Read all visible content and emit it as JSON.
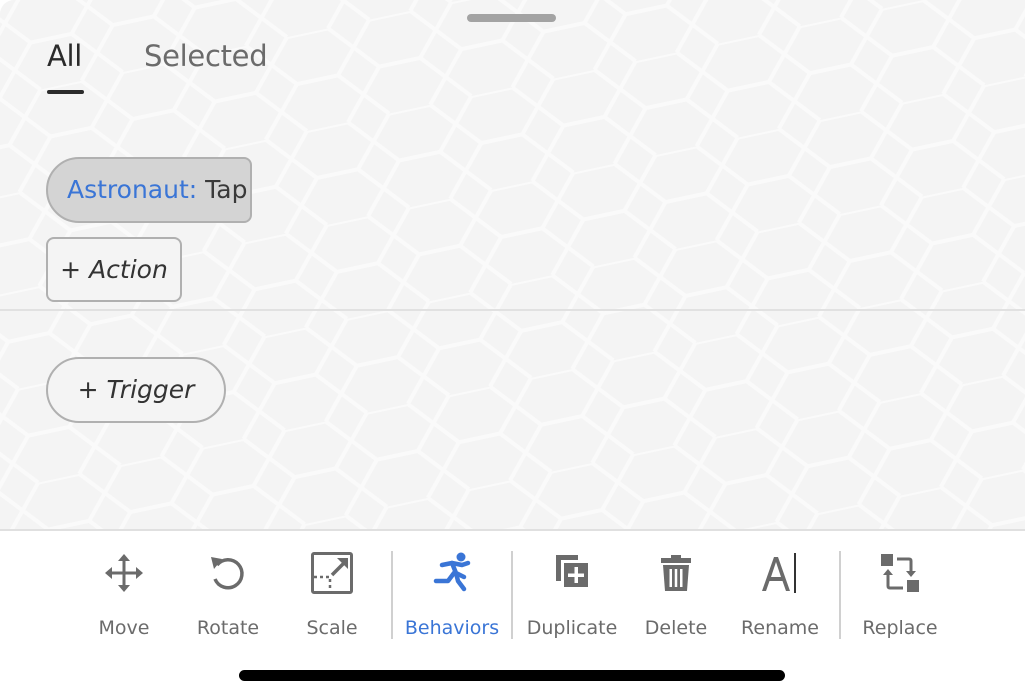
{
  "tabs": [
    {
      "label": "All",
      "active": true
    },
    {
      "label": "Selected",
      "active": false
    }
  ],
  "behavior": {
    "trigger_object": "Astronaut:",
    "trigger_event": "Tap",
    "add_action_label": "+ Action",
    "add_trigger_label": "+ Trigger"
  },
  "toolbar": {
    "items": [
      {
        "label": "Move",
        "icon": "move-icon"
      },
      {
        "label": "Rotate",
        "icon": "rotate-icon"
      },
      {
        "label": "Scale",
        "icon": "scale-icon"
      },
      {
        "label": "Behaviors",
        "icon": "behaviors-running-icon",
        "active": true
      },
      {
        "label": "Duplicate",
        "icon": "duplicate-icon"
      },
      {
        "label": "Delete",
        "icon": "trash-icon"
      },
      {
        "label": "Rename",
        "icon": "rename-icon"
      },
      {
        "label": "Replace",
        "icon": "replace-icon"
      }
    ]
  },
  "colors": {
    "accent": "#3a75d6",
    "icon_gray": "#6b6b6b",
    "sheet_bg": "#f4f4f4",
    "chip_bg": "#d4d4d4"
  }
}
